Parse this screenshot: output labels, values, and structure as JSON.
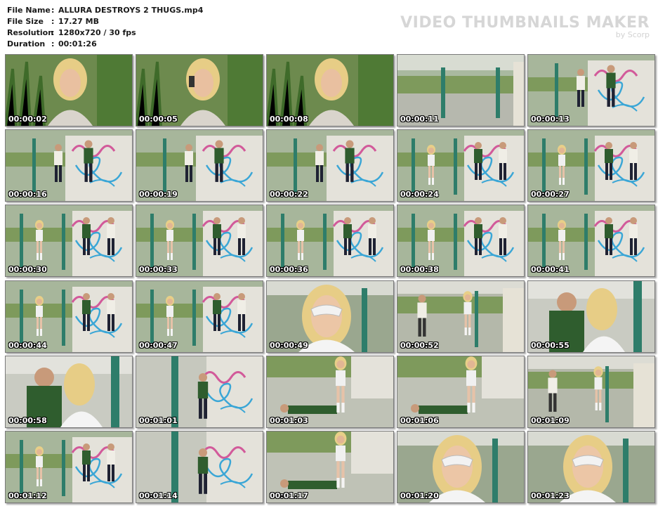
{
  "file_info": [
    {
      "key": "File Name",
      "value": "ALLURA DESTROYS 2 THUGS.mp4"
    },
    {
      "key": "File Size",
      "value": "17.27 MB"
    },
    {
      "key": "Resolution",
      "value": "1280x720 / 30 fps"
    },
    {
      "key": "Duration",
      "value": "00:01:26"
    }
  ],
  "brand": {
    "title": "VIDEO THUMBNAILS MAKER",
    "subtitle": "by Scorp"
  },
  "colon": ":",
  "thumbnails": [
    {
      "time": "00:00:02",
      "scene": "portrait-plants"
    },
    {
      "time": "00:00:05",
      "scene": "portrait-phone"
    },
    {
      "time": "00:00:08",
      "scene": "portrait-plants"
    },
    {
      "time": "00:00:11",
      "scene": "pavilion-empty"
    },
    {
      "time": "00:00:13",
      "scene": "graffiti-two-men"
    },
    {
      "time": "00:00:16",
      "scene": "graffiti-two-men"
    },
    {
      "time": "00:00:19",
      "scene": "graffiti-two-men"
    },
    {
      "time": "00:00:22",
      "scene": "graffiti-two-men"
    },
    {
      "time": "00:00:24",
      "scene": "graffiti-three"
    },
    {
      "time": "00:00:27",
      "scene": "graffiti-three"
    },
    {
      "time": "00:00:30",
      "scene": "graffiti-three"
    },
    {
      "time": "00:00:33",
      "scene": "graffiti-three"
    },
    {
      "time": "00:00:36",
      "scene": "graffiti-three"
    },
    {
      "time": "00:00:38",
      "scene": "graffiti-three"
    },
    {
      "time": "00:00:41",
      "scene": "graffiti-three"
    },
    {
      "time": "00:00:44",
      "scene": "graffiti-three"
    },
    {
      "time": "00:00:47",
      "scene": "graffiti-three"
    },
    {
      "time": "00:00:49",
      "scene": "closeup-mask"
    },
    {
      "time": "00:00:52",
      "scene": "fight-wide"
    },
    {
      "time": "00:00:55",
      "scene": "closeup-fight"
    },
    {
      "time": "00:00:58",
      "scene": "closeup-fight"
    },
    {
      "time": "00:01:01",
      "scene": "graffiti-fight"
    },
    {
      "time": "00:01:03",
      "scene": "fight-ground"
    },
    {
      "time": "00:01:06",
      "scene": "fight-ground"
    },
    {
      "time": "00:01:09",
      "scene": "fight-wide"
    },
    {
      "time": "00:01:12",
      "scene": "graffiti-three"
    },
    {
      "time": "00:01:14",
      "scene": "graffiti-fight"
    },
    {
      "time": "00:01:17",
      "scene": "fight-ground"
    },
    {
      "time": "00:01:20",
      "scene": "closeup-mask"
    },
    {
      "time": "00:01:23",
      "scene": "closeup-mask"
    }
  ]
}
